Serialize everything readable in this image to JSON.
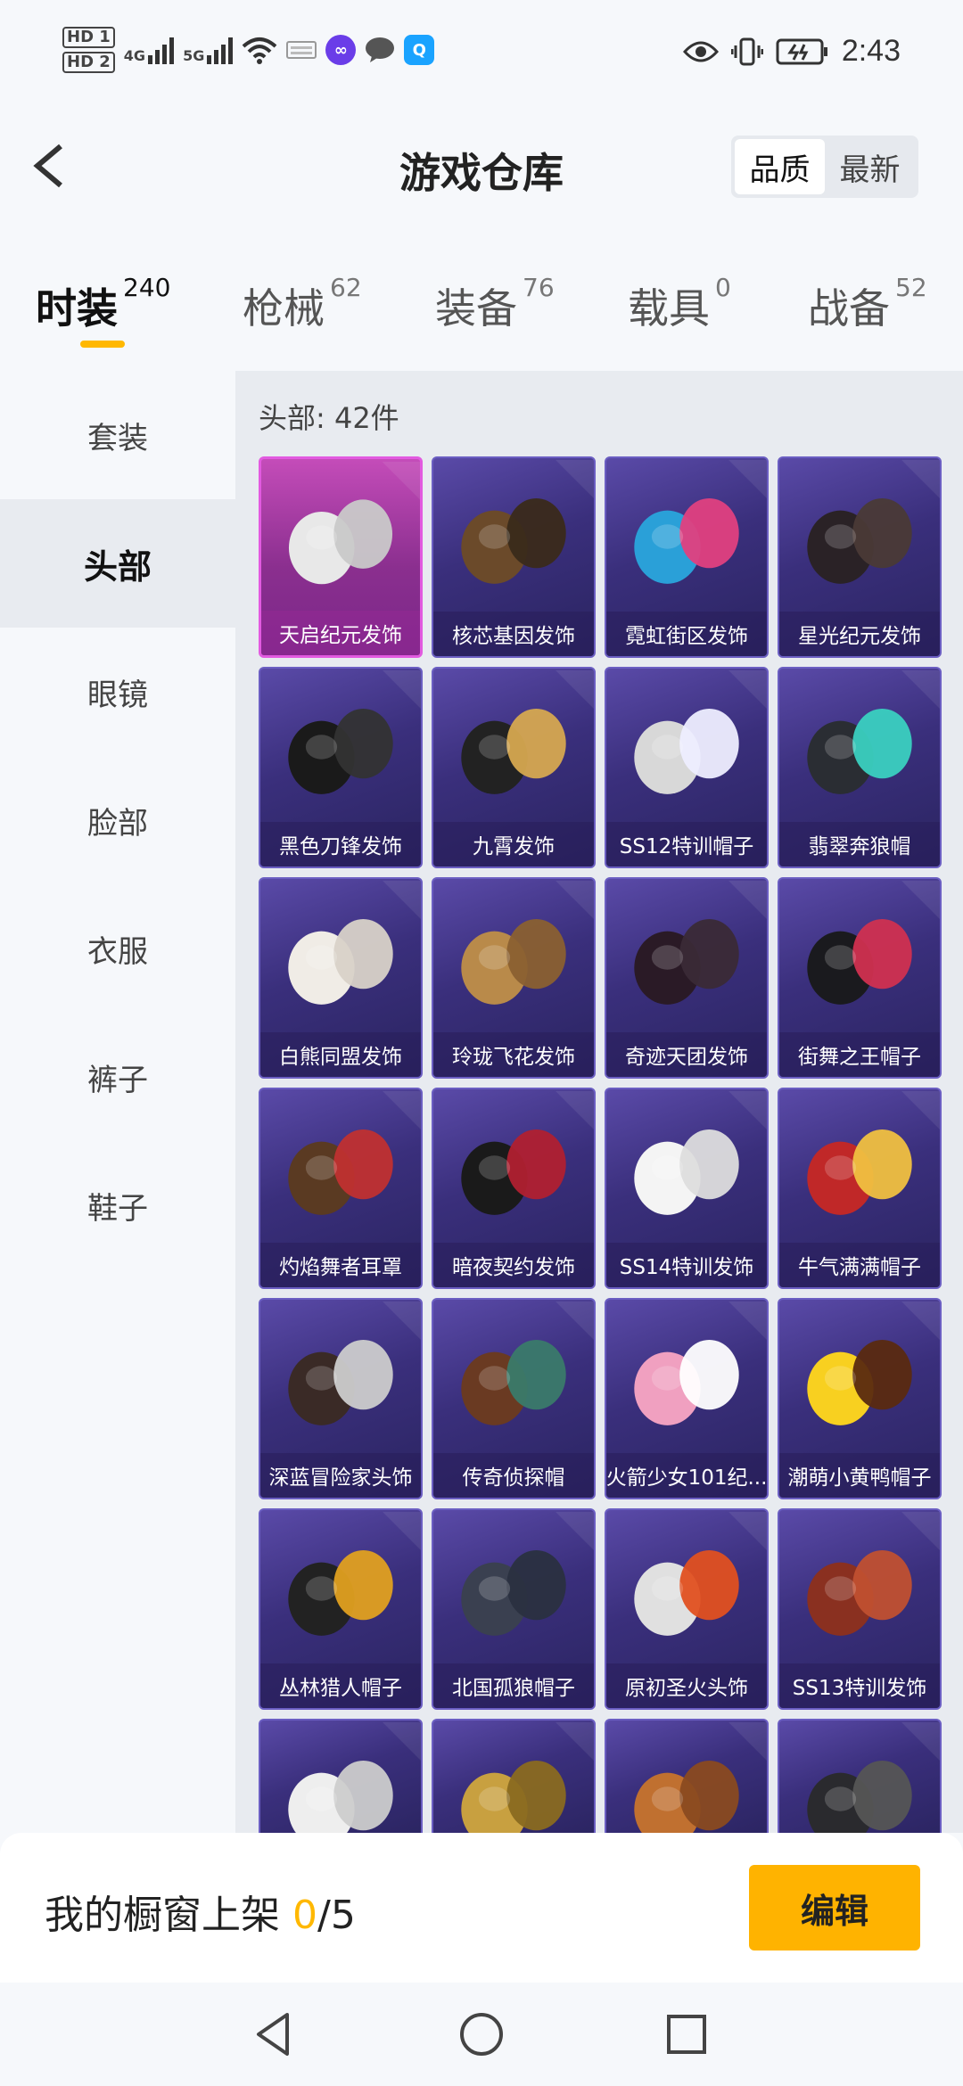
{
  "status_bar": {
    "hd1": "HD 1",
    "hd2": "HD 2",
    "net1": "4G",
    "net2": "5G",
    "time": "2:43"
  },
  "header": {
    "title": "游戏仓库",
    "sort_options": [
      "品质",
      "最新"
    ],
    "sort_active": "品质"
  },
  "tabs": [
    {
      "label": "时装",
      "count": "240"
    },
    {
      "label": "枪械",
      "count": "62"
    },
    {
      "label": "装备",
      "count": "76"
    },
    {
      "label": "载具",
      "count": "0"
    },
    {
      "label": "战备",
      "count": "52"
    }
  ],
  "sidebar": {
    "items": [
      "套装",
      "头部",
      "眼镜",
      "脸部",
      "衣服",
      "裤子",
      "鞋子"
    ],
    "active": "头部"
  },
  "main": {
    "section_title": "头部: 42件",
    "items": [
      "天启纪元发饰",
      "核芯基因发饰",
      "霓虹街区发饰",
      "星光纪元发饰",
      "黑色刀锋发饰",
      "九霄发饰",
      "SS12特训帽子",
      "翡翠奔狼帽",
      "白熊同盟发饰",
      "玲珑飞花发饰",
      "奇迹天团发饰",
      "街舞之王帽子",
      "灼焰舞者耳罩",
      "暗夜契约发饰",
      "SS14特训发饰",
      "牛气满满帽子",
      "深蓝冒险家头饰",
      "传奇侦探帽",
      "火箭少女101纪...",
      "潮萌小黄鸭帽子",
      "丛林猎人帽子",
      "北国孤狼帽子",
      "原初圣火头饰",
      "SS13特训发饰",
      "",
      "",
      "",
      ""
    ]
  },
  "bottom_bar": {
    "showcase_label": "我的橱窗上架 ",
    "showcase_count": "0",
    "showcase_total": "/5",
    "edit_label": "编辑"
  },
  "colors": {
    "accent": "#ffb800",
    "card_purple": "#3a2f7c",
    "card_featured": "#c44cb9"
  }
}
